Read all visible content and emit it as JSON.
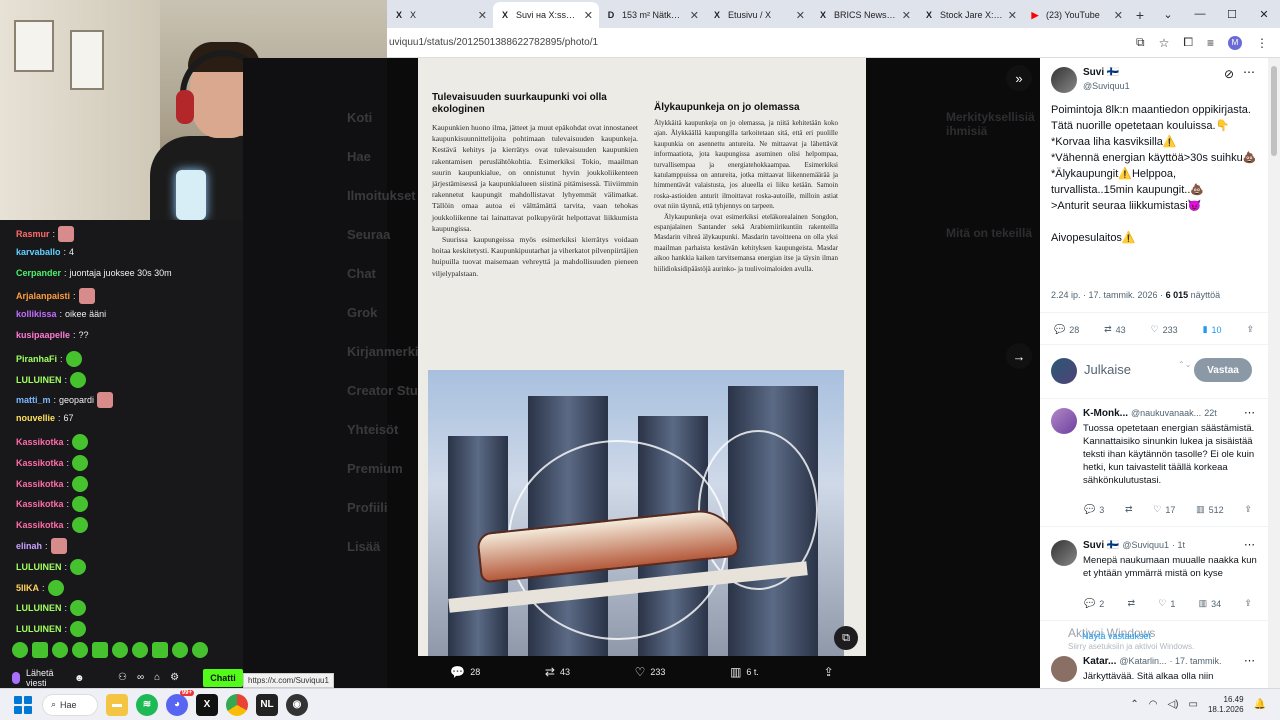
{
  "browser": {
    "tabs": [
      {
        "title": "X",
        "icon": "x-logo-icon",
        "active": false
      },
      {
        "title": "Suvi на X:ssä: \"Po",
        "icon": "x-logo-icon",
        "active": true
      },
      {
        "title": "153 m² Nätkelm",
        "icon": "d-logo-icon",
        "active": false
      },
      {
        "title": "Etusivu / X",
        "icon": "x-logo-icon",
        "active": false
      },
      {
        "title": "BRICS News X:ss",
        "icon": "x-logo-icon",
        "active": false
      },
      {
        "title": "Stock Jare X:ssä",
        "icon": "x-logo-icon",
        "active": false
      },
      {
        "title": "(23) YouTube",
        "icon": "youtube-icon",
        "active": false
      }
    ],
    "url": "uviquu1/status/2012501388622782895/photo/1",
    "profile_initial": "M"
  },
  "chat": {
    "messages": [
      {
        "user": "Rasmur",
        "user_color": "#ff6b6b",
        "text": "",
        "emote": "sq"
      },
      {
        "user": "karvaballo",
        "user_color": "#5fd3ff",
        "text": "4",
        "emote": ""
      },
      {
        "user": "Cerpander",
        "user_color": "#4bf26b",
        "text": "juontaja juoksee 30s 30m",
        "emote": ""
      },
      {
        "user": "Arjalanpaisti",
        "user_color": "#ff9e3d",
        "text": "",
        "emote": "sq"
      },
      {
        "user": "kollikissa",
        "user_color": "#c56cff",
        "text": "oikee ääni",
        "emote": ""
      },
      {
        "user": "kusipaapelle",
        "user_color": "#ff7ad6",
        "text": "??",
        "emote": ""
      },
      {
        "user": "PiranhaFi",
        "user_color": "#a0ff5e",
        "text": "",
        "emote": "round"
      },
      {
        "user": "LULUINEN",
        "user_color": "#a0ff5e",
        "text": "",
        "emote": "round"
      },
      {
        "user": "matti_m",
        "user_color": "#7cb8ff",
        "text": "geopardi",
        "emote": "sq"
      },
      {
        "user": "nouvellie",
        "user_color": "#ffe15a",
        "text": "67",
        "emote": ""
      },
      {
        "user": "Kassikotka",
        "user_color": "#ff6ba8",
        "text": "",
        "emote": "round"
      },
      {
        "user": "Kassikotka",
        "user_color": "#ff6ba8",
        "text": "",
        "emote": "round"
      },
      {
        "user": "Kassikotka",
        "user_color": "#ff6ba8",
        "text": "",
        "emote": "round"
      },
      {
        "user": "Kassikotka",
        "user_color": "#ff6ba8",
        "text": "",
        "emote": "round"
      },
      {
        "user": "Kassikotka",
        "user_color": "#ff6ba8",
        "text": "",
        "emote": "round"
      },
      {
        "user": "elinah",
        "user_color": "#c9a0ff",
        "text": "",
        "emote": "sq"
      },
      {
        "user": "LULUINEN",
        "user_color": "#a0ff5e",
        "text": "",
        "emote": "round"
      },
      {
        "user": "5IIKA",
        "user_color": "#ffd15c",
        "text": "",
        "emote": "round"
      },
      {
        "user": "LULUINEN",
        "user_color": "#a0ff5e",
        "text": "",
        "emote": "round"
      },
      {
        "user": "LULUINEN",
        "user_color": "#a0ff5e",
        "text": "",
        "emote": "round"
      }
    ],
    "send_label": "Lähetä viesti",
    "chat_button": "Chatti",
    "status_url": "https://x.com/Suviquu1"
  },
  "ghost": {
    "nav": [
      "Koti",
      "Hae",
      "Ilmoitukset",
      "Seuraa",
      "Chat",
      "Grok",
      "Kirjanmerkit",
      "Creator Studio",
      "Yhteisöt",
      "Premium",
      "Profiili",
      "Lisää"
    ],
    "right_title": "Merkityksellisiä ihmisiä",
    "right_title2": "Mitä on tekeillä"
  },
  "photo": {
    "left_heading": "Tulevaisuuden suurkaupunki voi olla ekologinen",
    "left_p1": "Kaupunkien huono ilma, jätteet ja muut epäkohdat ovat innostaneet kaupunkisuunnittelijoita pohtimaan tulevaisuuden kaupunkeja. Kestävä kehitys ja kierrätys ovat tulevaisuuden kaupunkien rakentamisen peruslähtökohtia. Esimerkiksi Tokio, maailman suurin kaupunkialue, on onnistunut hyvin joukkoliikenteen järjestämisessä ja kaupunkialueen siistinä pitämisessä. Tiiviimmin rakennetut kaupungit mahdollistavat lyhyemmät välimatkat. Tällöin omaa autoa ei välttämättä tarvita, vaan tehokas joukkoliikenne tai lainattavat polkupyörät helpottavat liikkumista kaupungissa.",
    "left_p2": "Suurissa kaupungeissa myös esimerkiksi kierrätys voidaan hoitaa keskitetysti. Kaupunkipuutarhat ja viherkatot pilvenpiirtäjien huipuilla tuovat maisemaan vehreyttä ja mahdollisuuden pieneen viljelypalstaan.",
    "right_heading": "Älykaupunkeja on jo olemassa",
    "right_p1": "Älykkäitä kaupunkeja on jo olemassa, ja niitä kehitetään koko ajan. Älykkäällä kaupungilla tarkoitetaan sitä, että eri puolille kaupunkia on asennettu antureita. Ne mittaavat ja lähettävät informaatiota, jota kaupungissa asuminen olisi helpompaa, turvallisempaa ja energiatehokkaampaa. Esimerkiksi katulamppuissa on antureita, jotka mittaavat liikennemäärää ja himmentävät valaistusta, jos alueella ei liiku ketään. Samoin roska-astioiden anturit ilmoittavat roska-autoille, milloin astiat ovat niin täynnä, että tyhjennys on tarpeen.",
    "right_p2": "Älykaupunkeja ovat esimerkiksi eteläkorealainen Songdon, espanjalainen Santander sekä Arabiemiirikuntiin rakenteilla Masdarin vihreä älykaupunki. Masdarin tavoitteena on olla yksi maailman parhaista kestävän kehityksen kaupungeista. Masdar aikoo hankkia kaiken tarvitsemansa energian itse ja täysin ilman hiilidioksidipäästöjä aurinko- ja tuulivoimaloiden avulla."
  },
  "actionbar": {
    "replies": "28",
    "reposts": "43",
    "likes": "233",
    "views": "6 t."
  },
  "panel": {
    "author_name": "Suvi 🇫🇮",
    "author_handle": "@Suviquu1",
    "tweet_text": "Poimintoja 8lk:n maantiedon oppikirjasta.\nTätä nuorille opetetaan kouluissa.👇\n*Korvaa liha kasviksilla⚠️\n*Vähennä energian käyttöä>30s suihku💩\n*Älykaupungit⚠️Helppoa, turvallista..15min kaupungit..💩\n>Anturit seuraa liikkumistasi😈\n\nAivopesulaitos⚠️",
    "meta_time": "2.24 ip. · 17. tammik. 2026 · ",
    "meta_views": "6 015",
    "meta_views_label": " näyttöä",
    "stats": {
      "replies": "28",
      "reposts": "43",
      "likes": "233",
      "bookmarks": "10"
    },
    "reply_placeholder": "Julkaise",
    "reply_button": "Vastaa",
    "replies": [
      {
        "name": "K-Monk...",
        "handle": "@naukuvanaak...",
        "time": "22t",
        "text": "Tuossa opetetaan energian säästämistä. Kannattaisiko sinunkin lukea ja sisäistää teksti ihan käytännön tasolle? Ei ole kuin hetki, kun taivastelit täällä korkeaa sähkönkulutustasi.",
        "replies": "3",
        "reposts": "",
        "likes": "17",
        "views": "512"
      },
      {
        "name": "Suvi 🇫🇮",
        "handle": "@Suviquu1",
        "time": "· 1t",
        "text": "Menepä naukumaan muualle naakka kun et yhtään ymmärrä mistä on kyse",
        "replies": "2",
        "reposts": "",
        "likes": "1",
        "views": "34"
      },
      {
        "name": "Katar...",
        "handle": "@Katarlin...",
        "time": "· 17. tammik.",
        "text": "Järkyttävää. Sitä alkaa olla niin",
        "replies": "",
        "reposts": "",
        "likes": "",
        "views": ""
      }
    ],
    "show_replies": "Näytä vastaukset",
    "watermark_title": "Aktivoi Windows",
    "watermark_sub": "Siirry asetuksiin ja aktivoi Windows."
  },
  "taskbar": {
    "search_label": "Hae",
    "time": "16.49",
    "date": "18.1.2026",
    "badge_count": "99+"
  }
}
